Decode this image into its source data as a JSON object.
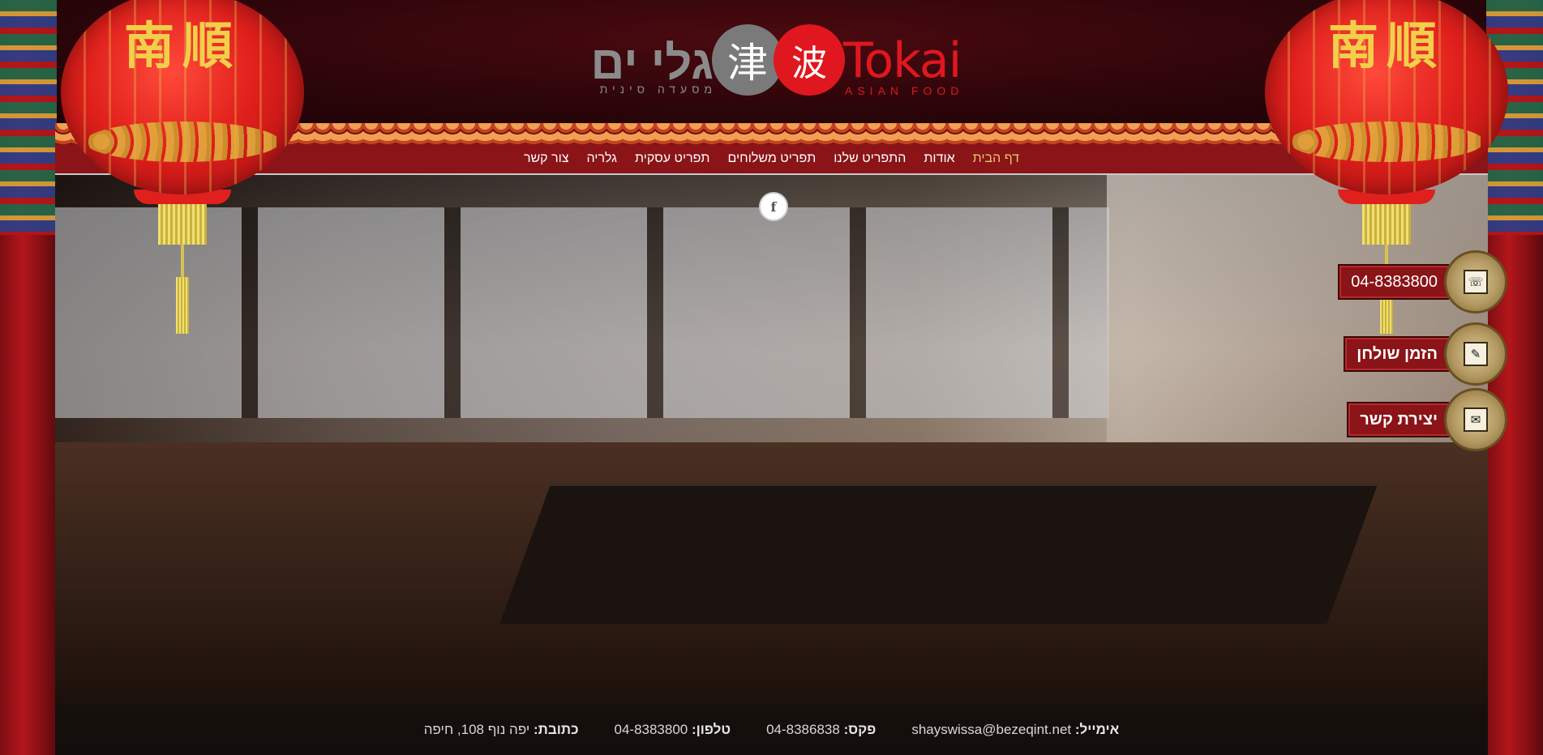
{
  "logo": {
    "hebrew_name": "גלי ים",
    "hebrew_sub": "מסעדה סינית",
    "char1": "津",
    "char2": "波",
    "english_name": "Tokai",
    "english_sub": "ASIAN FOOD"
  },
  "nav": {
    "items": [
      {
        "label": "דף הבית",
        "active": true
      },
      {
        "label": "אודות"
      },
      {
        "label": "התפריט שלנו"
      },
      {
        "label": "תפריט משלוחים"
      },
      {
        "label": "תפריט עסקית"
      },
      {
        "label": "גלריה"
      },
      {
        "label": "צור קשר"
      }
    ]
  },
  "facebook": {
    "icon": "facebook-icon",
    "glyph": "f"
  },
  "lanterns": {
    "characters": "南順"
  },
  "widgets": {
    "phone": {
      "label": "04-8383800",
      "icon": "phone-icon",
      "glyph": "☏"
    },
    "reserve": {
      "label": "הזמן שולחן",
      "icon": "reservation-icon",
      "glyph": "✎"
    },
    "contact": {
      "label": "יצירת קשר",
      "icon": "mail-icon",
      "glyph": "✉"
    }
  },
  "footer": {
    "address_key": "כתובת:",
    "address_val": "יפה נוף 108, חיפה",
    "phone_key": "טלפון:",
    "phone_val": "04-8383800",
    "fax_key": "פקס:",
    "fax_val": "04-8386838",
    "email_key": "אימייל:",
    "email_val": "shayswissa@bezeqint.net"
  },
  "colors": {
    "accent_red": "#e0171e",
    "nav_bg": "#8a1418",
    "active_gold": "#e4c86f"
  }
}
